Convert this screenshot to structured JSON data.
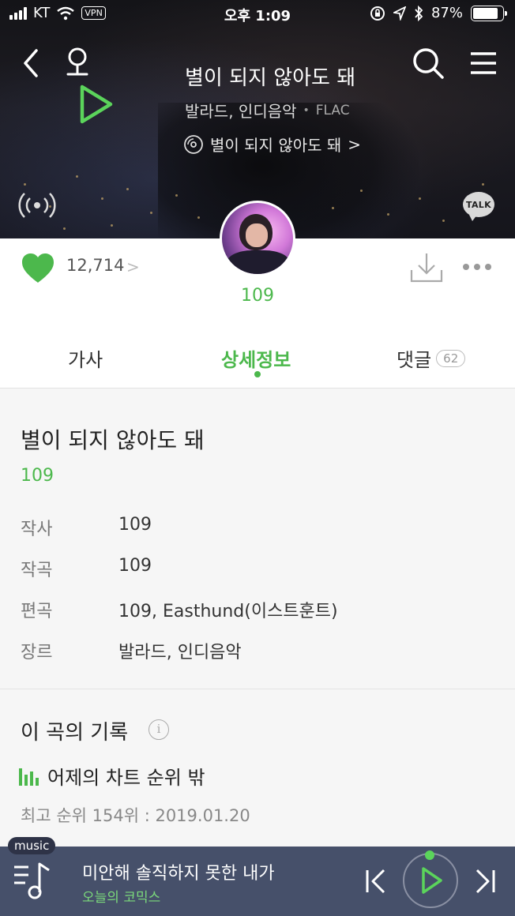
{
  "status_bar": {
    "carrier": "KT",
    "vpn": "VPN",
    "time": "오후 1:09",
    "battery": "87%",
    "battery_level": 0.87
  },
  "header": {
    "song_title": "별이 되지 않아도 돼",
    "genre": "발라드, 인디음악",
    "separator": "•",
    "format": "FLAC",
    "album": "별이 되지 않아도 돼",
    "album_chevron": ">",
    "talk_label": "TALK"
  },
  "artist_row": {
    "like_count": "12,714",
    "like_chevron": ">",
    "artist_name": "109"
  },
  "tabs": {
    "lyrics": "가사",
    "detail": "상세정보",
    "comments": "댓글",
    "comment_count": "62"
  },
  "detail": {
    "title": "별이 되지 않아도 돼",
    "artist": "109",
    "rows": [
      {
        "label": "작사",
        "value": "109"
      },
      {
        "label": "작곡",
        "value": "109"
      },
      {
        "label": "편곡",
        "value": "109, Easthund(이스트훈트)"
      },
      {
        "label": "장르",
        "value": "발라드, 인디음악"
      }
    ]
  },
  "history": {
    "title": "이 곡의 기록",
    "info_glyph": "i",
    "chart_status": "어제의 차트 순위 밖",
    "best_rank": "최고 순위 154위 : 2019.01.20"
  },
  "player": {
    "badge": "music",
    "now_title": "미안해 솔직하지 못한 내가",
    "now_artist": "오늘의 코믹스"
  },
  "colors": {
    "accent_green": "#4cb84c",
    "player_bg": "#46506a"
  },
  "icons": [
    "back-icon",
    "mic-icon",
    "play-icon",
    "search-icon",
    "menu-icon",
    "radio-icon",
    "talk-icon",
    "disc-icon",
    "heart-icon",
    "download-icon",
    "more-icon",
    "info-icon",
    "chart-icon",
    "playlist-icon",
    "prev-icon",
    "next-icon"
  ]
}
